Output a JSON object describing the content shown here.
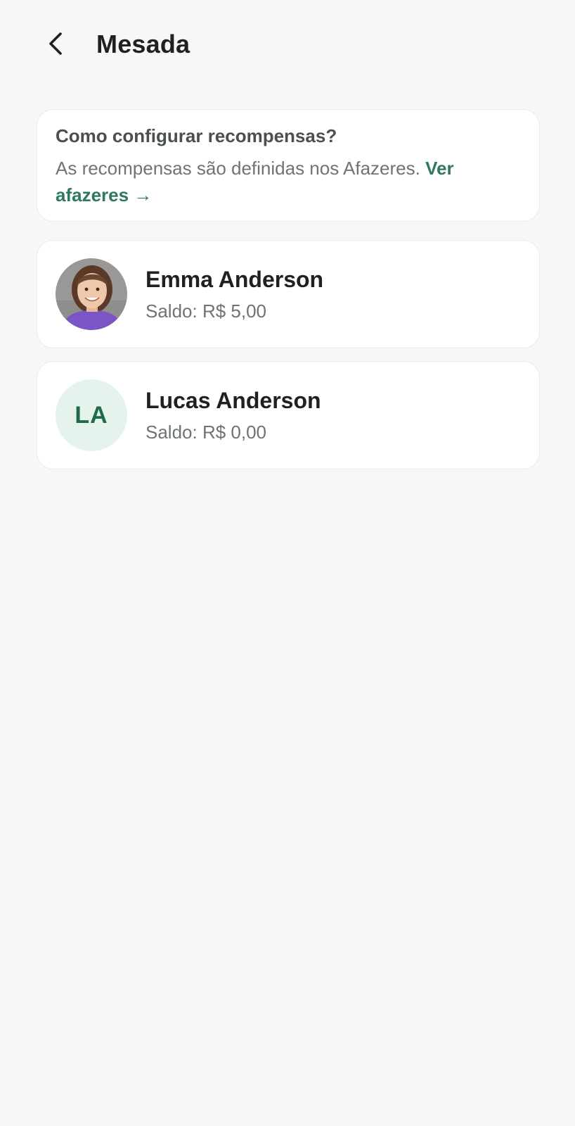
{
  "header": {
    "title": "Mesada",
    "back_icon": "chevron-left-icon"
  },
  "info_card": {
    "title": "Como configurar recompensas?",
    "text": "As recompensas são definidas nos Afazeres.",
    "link_label": "Ver afazeres →"
  },
  "members": [
    {
      "name": "Emma Anderson",
      "balance": "Saldo: R$ 5,00",
      "avatar_type": "photo"
    },
    {
      "name": "Lucas Anderson",
      "balance": "Saldo: R$ 0,00",
      "avatar_type": "initials",
      "initials": "LA"
    }
  ],
  "colors": {
    "accent": "#2f7a5e",
    "background": "#f6f7f6",
    "initials_bg": "#e5f3ec",
    "initials_text": "#1f6a4a"
  }
}
